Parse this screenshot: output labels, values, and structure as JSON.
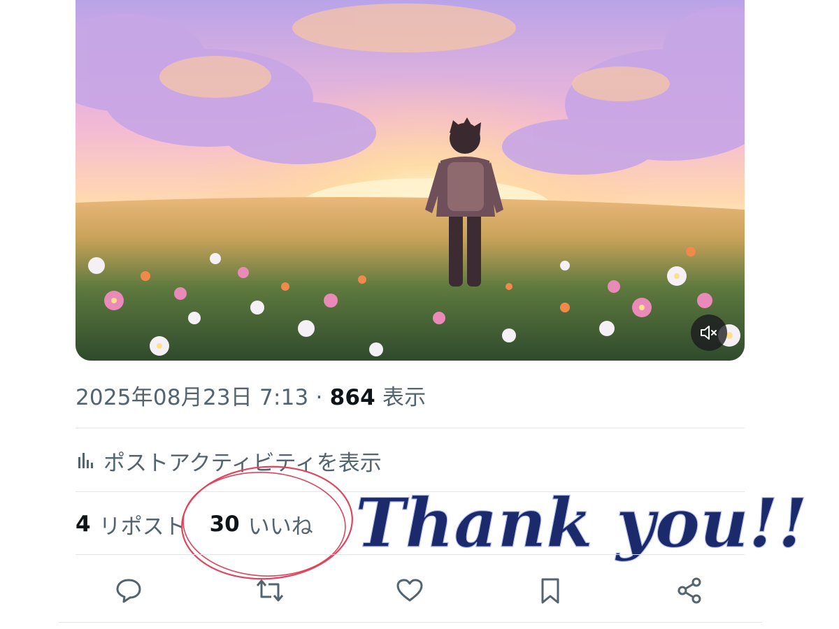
{
  "post": {
    "timestamp": "2025年08月23日 7:13",
    "separator": "·",
    "views_count": "864",
    "views_label": "表示",
    "activity_link": "ポストアクティビティを表示",
    "reposts": {
      "count": "4",
      "label": "リポスト"
    },
    "likes": {
      "count": "30",
      "label": "いいね"
    }
  },
  "media": {
    "scene": "anime-style illustration of a boy walking through a flower field at sunset",
    "mute_icon": "speaker-muted-icon"
  },
  "actions": [
    {
      "name": "reply",
      "icon": "speech-bubble-icon"
    },
    {
      "name": "repost",
      "icon": "repost-arrows-icon"
    },
    {
      "name": "like",
      "icon": "heart-icon"
    },
    {
      "name": "bookmark",
      "icon": "bookmark-icon"
    },
    {
      "name": "share",
      "icon": "share-nodes-icon"
    }
  ],
  "overlay": {
    "thank_you_text": "Thank you!!",
    "text_color": "#1b2a6b",
    "circle_color": "#e0455d"
  },
  "colors": {
    "text_primary": "#0f1419",
    "text_secondary": "#536471",
    "divider": "#e3e6e8"
  }
}
